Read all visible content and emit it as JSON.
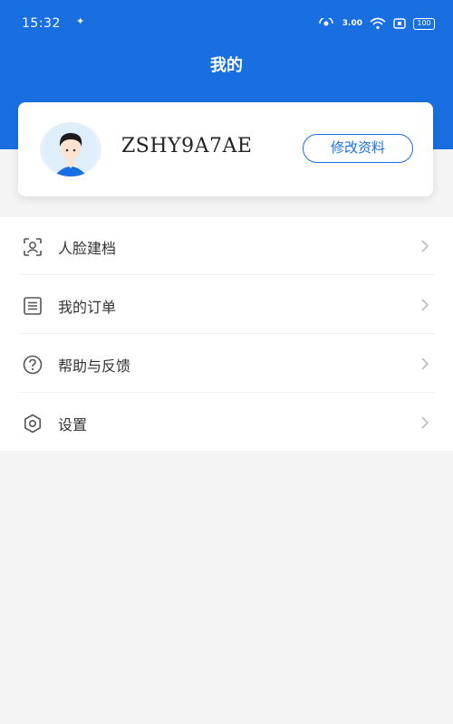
{
  "status_bar": {
    "time": "15:32",
    "signal_rate": "3.00",
    "battery": "100"
  },
  "header": {
    "title": "我的"
  },
  "profile": {
    "username": "ZSHY9A7AE",
    "edit_label": "修改资料"
  },
  "menu": {
    "items": [
      {
        "label": "人脸建档",
        "icon": "face-scan-icon"
      },
      {
        "label": "我的订单",
        "icon": "order-list-icon"
      },
      {
        "label": "帮助与反馈",
        "icon": "help-icon"
      },
      {
        "label": "设置",
        "icon": "settings-icon"
      }
    ]
  },
  "colors": {
    "primary": "#1a6fe0",
    "background": "#f4f4f5",
    "card": "#ffffff"
  }
}
